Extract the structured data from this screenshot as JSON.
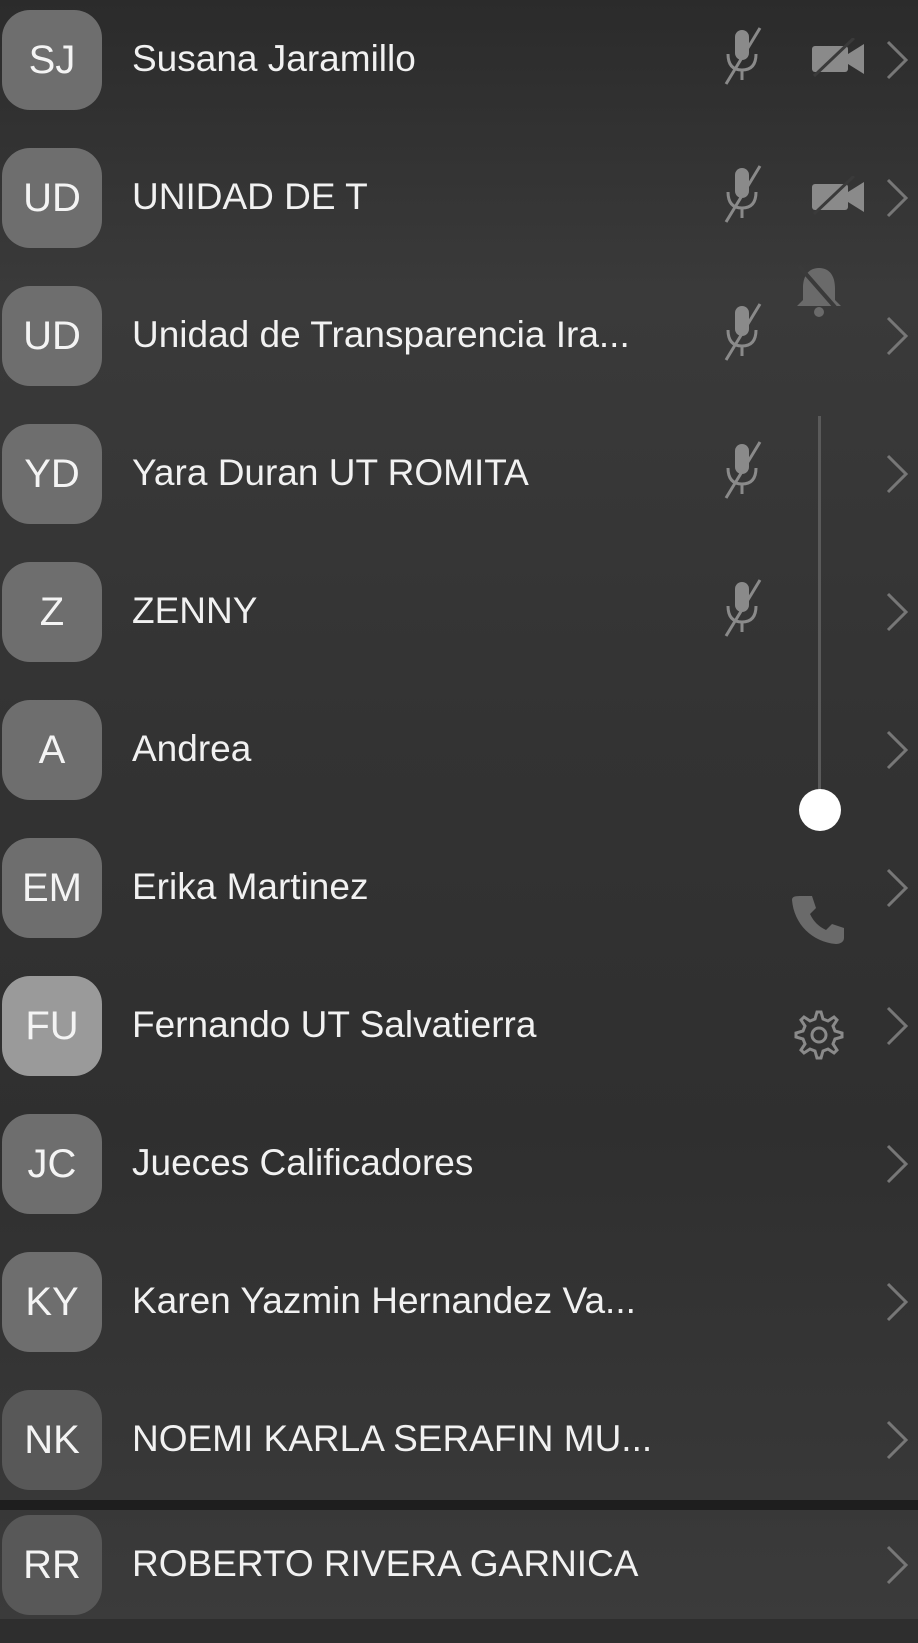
{
  "participants": [
    {
      "initials": "SJ",
      "name": "Susana Jaramillo",
      "mic_muted": true,
      "video_off": true
    },
    {
      "initials": "UD",
      "name": "UNIDAD DE T",
      "mic_muted": true,
      "video_off": true
    },
    {
      "initials": "UD",
      "name": "Unidad de Transparencia Ira...",
      "mic_muted": true,
      "video_off": false
    },
    {
      "initials": "YD",
      "name": "Yara Duran UT ROMITA",
      "mic_muted": true,
      "video_off": false
    },
    {
      "initials": "Z",
      "name": "ZENNY",
      "mic_muted": true,
      "video_off": false
    },
    {
      "initials": "A",
      "name": "Andrea",
      "mic_muted": false,
      "video_off": false
    },
    {
      "initials": "EM",
      "name": "Erika Martinez",
      "mic_muted": false,
      "video_off": false
    },
    {
      "initials": "FU",
      "name": "Fernando UT Salvatierra",
      "mic_muted": false,
      "video_off": false
    },
    {
      "initials": "JC",
      "name": "Jueces Calificadores",
      "mic_muted": false,
      "video_off": false
    },
    {
      "initials": "KY",
      "name": "Karen Yazmin Hernandez Va...",
      "mic_muted": false,
      "video_off": false
    },
    {
      "initials": "NK",
      "name": "NOEMI KARLA SERAFIN MU...",
      "mic_muted": false,
      "video_off": false
    },
    {
      "initials": "RR",
      "name": "ROBERTO RIVERA GARNICA",
      "mic_muted": false,
      "video_off": false
    }
  ],
  "overlay_controls": {
    "volume_level": 0.1,
    "icons": [
      "bell-muted-icon",
      "phone-icon",
      "gear-icon"
    ]
  },
  "colors": {
    "text": "#f1f1f1",
    "avatar_bg": "#6e6e6e",
    "icon_muted": "#8a8a8a"
  }
}
